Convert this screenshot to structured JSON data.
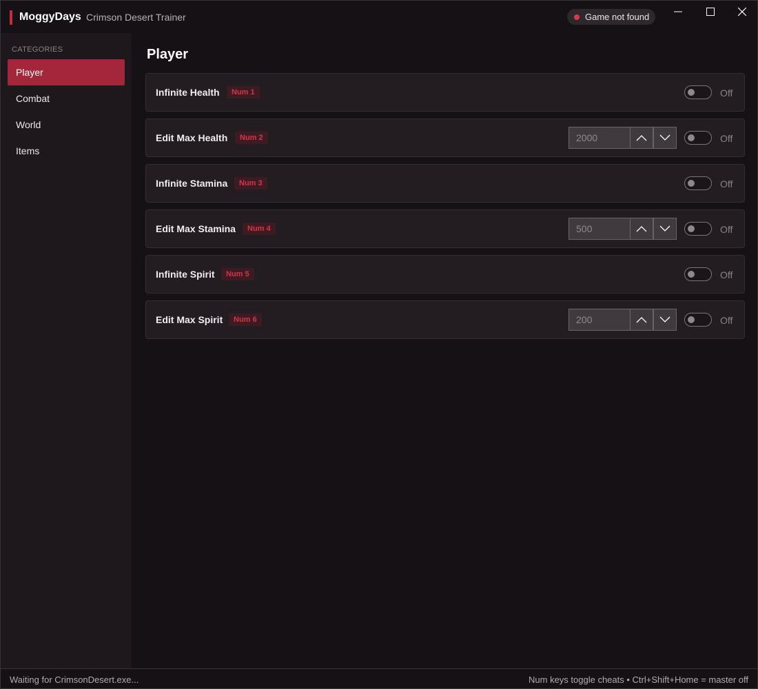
{
  "titlebar": {
    "brand": "MoggyDays",
    "subtitle": "Crimson Desert Trainer",
    "status": "Game not found",
    "status_color": "#e0354c",
    "accent_color": "#c8293f",
    "window_buttons": [
      "minimize-icon",
      "maximize-icon",
      "close-icon"
    ]
  },
  "sidebar": {
    "heading": "CATEGORIES",
    "items": [
      {
        "label": "Player",
        "active": true
      },
      {
        "label": "Combat",
        "active": false
      },
      {
        "label": "World",
        "active": false
      },
      {
        "label": "Items",
        "active": false
      }
    ]
  },
  "main": {
    "title": "Player",
    "toggle_off_label": "Off",
    "cheats": [
      {
        "name": "Infinite Health",
        "hotkey": "Num 1",
        "state": "Off",
        "has_value": false
      },
      {
        "name": "Edit Max Health",
        "hotkey": "Num 2",
        "state": "Off",
        "has_value": true,
        "value": "2000"
      },
      {
        "name": "Infinite Stamina",
        "hotkey": "Num 3",
        "state": "Off",
        "has_value": false
      },
      {
        "name": "Edit Max Stamina",
        "hotkey": "Num 4",
        "state": "Off",
        "has_value": true,
        "value": "500"
      },
      {
        "name": "Infinite Spirit",
        "hotkey": "Num 5",
        "state": "Off",
        "has_value": false
      },
      {
        "name": "Edit Max Spirit",
        "hotkey": "Num 6",
        "state": "Off",
        "has_value": true,
        "value": "200"
      }
    ]
  },
  "statusbar": {
    "left": "Waiting for CrimsonDesert.exe...",
    "right": "Num keys toggle cheats  •  Ctrl+Shift+Home = master off"
  }
}
